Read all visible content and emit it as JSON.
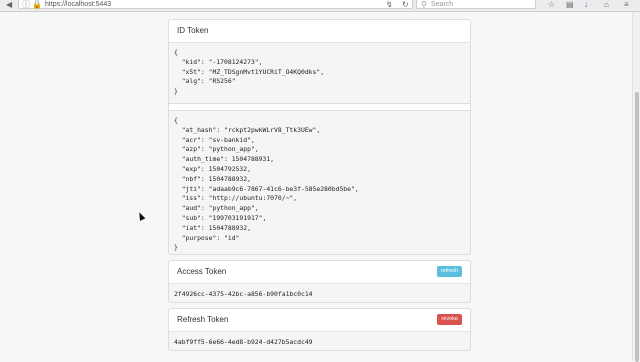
{
  "browser": {
    "url": "https://localhost:5443",
    "search_placeholder": "Search"
  },
  "id_token_card": {
    "title": "ID Token",
    "header_json": "{\n  \"kid\": \"-1708124273\",\n  \"x5t\": \"MZ_TDSgnMvt1YUCRiT_O4KQ0dks\",\n  \"alg\": \"RS256\"\n}",
    "payload_json": "{\n  \"at_hash\": \"rckpt2pwkWLrV8_Ttk3UEw\",\n  \"acr\": \"sv-bankid\",\n  \"azp\": \"python_app\",\n  \"auth_time\": 1504788931,\n  \"exp\": 1504792532,\n  \"nbf\": 1504788932,\n  \"jti\": \"adaab9c6-7867-41c6-be3f-585e280bd5be\",\n  \"iss\": \"http://ubuntu:7070/~\",\n  \"aud\": \"python_app\",\n  \"sub\": \"199703191917\",\n  \"iat\": 1504788932,\n  \"purpose\": \"id\"\n}"
  },
  "access_token_card": {
    "title": "Access Token",
    "button_label": "refresh",
    "value": "2f4926cc-4375-42bc-a856-b90fa1bc0c14"
  },
  "refresh_token_card": {
    "title": "Refresh Token",
    "button_label": "revoke",
    "value": "4abf9ff5-6e66-4ed8-b924-d427b5acdc49"
  }
}
